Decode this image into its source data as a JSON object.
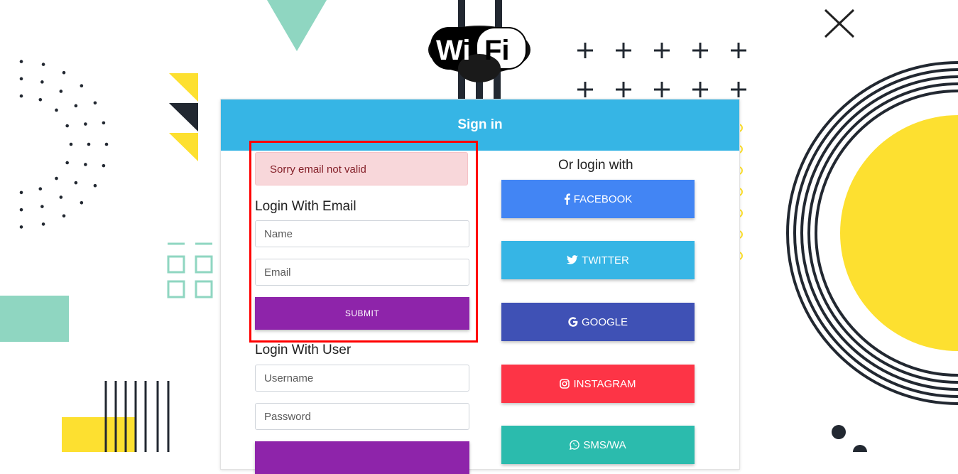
{
  "logo": {
    "text_wi": "Wi",
    "text_fi": "Fi"
  },
  "header": {
    "title": "Sign in"
  },
  "alert": {
    "message": "Sorry email not valid"
  },
  "email_login": {
    "title": "Login With Email",
    "name_placeholder": "Name",
    "email_placeholder": "Email",
    "submit_label": "SUBMIT"
  },
  "user_login": {
    "title": "Login With User",
    "username_placeholder": "Username",
    "password_placeholder": "Password"
  },
  "social": {
    "title": "Or login with",
    "buttons": [
      {
        "label": "FACEBOOK",
        "color": "#4285f4",
        "icon": "facebook-icon"
      },
      {
        "label": "TWITTER",
        "color": "#36b5e5",
        "icon": "twitter-icon"
      },
      {
        "label": "GOOGLE",
        "color": "#3f51b5",
        "icon": "google-icon"
      },
      {
        "label": "INSTAGRAM",
        "color": "#fd3446",
        "icon": "instagram-icon"
      },
      {
        "label": "SMS/WA",
        "color": "#2bbbad",
        "icon": "whatsapp-icon"
      }
    ]
  },
  "colors": {
    "accent": "#36b5e5",
    "submit": "#8e24aa",
    "yellow": "#fde030",
    "mint": "#8fd6c1",
    "dark": "#222831"
  }
}
